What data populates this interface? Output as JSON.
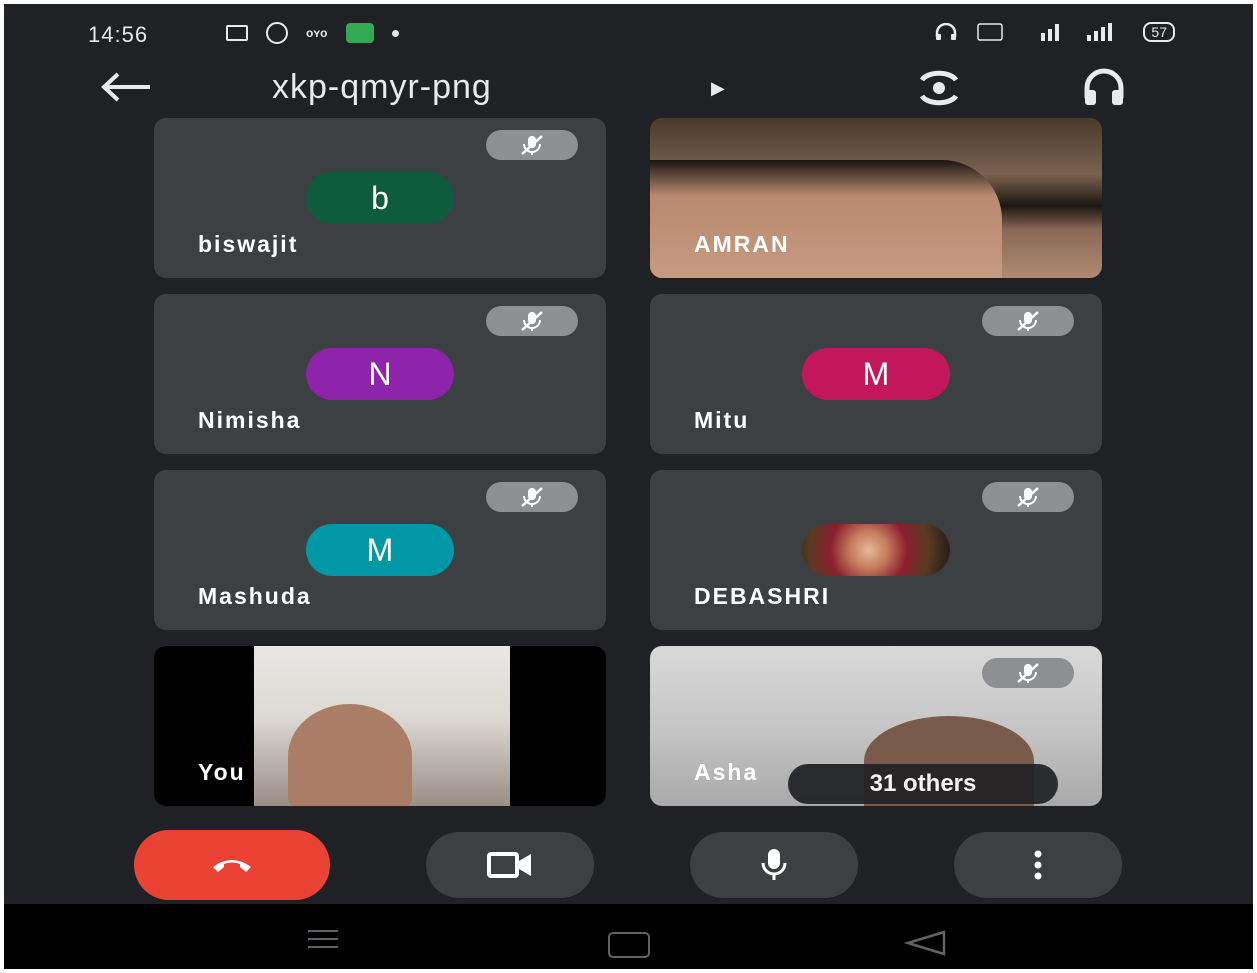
{
  "status_bar": {
    "time": "14:56",
    "left_icons": [
      "video-camera-icon",
      "whatsapp-icon",
      "oyo-icon",
      "call-icon",
      "dot-icon"
    ],
    "right_icons": [
      "headphones-icon",
      "volte-icon",
      "signal-4g-icon",
      "signal-icon"
    ],
    "battery": "57"
  },
  "header": {
    "title": "xkp-qmyr-png",
    "back_icon": "arrow-left-icon",
    "title_arrow_icon": "play-arrow-icon",
    "switch_camera_icon": "switch-camera-icon",
    "audio_output_icon": "headphones-icon"
  },
  "participants": [
    {
      "name": "biswajit",
      "initial": "b",
      "avatar_color": "#0f5b3e",
      "muted": true,
      "video": false
    },
    {
      "name": "AMRAN",
      "initial": "",
      "muted": false,
      "video": true
    },
    {
      "name": "Nimisha",
      "initial": "N",
      "avatar_color": "#8e24aa",
      "muted": true,
      "video": false
    },
    {
      "name": "Mitu",
      "initial": "M",
      "avatar_color": "#c2185b",
      "muted": true,
      "video": false
    },
    {
      "name": "Mashuda",
      "initial": "M",
      "avatar_color": "#0097a7",
      "muted": true,
      "video": false
    },
    {
      "name": "DEBASHRI",
      "initial": "",
      "muted": true,
      "video": false
    },
    {
      "name": "You",
      "initial": "",
      "muted": false,
      "video": true
    },
    {
      "name": "Asha",
      "initial": "",
      "muted": true,
      "video": true
    }
  ],
  "others_label": "31 others",
  "controls": {
    "end_call_icon": "end-call-icon",
    "camera_icon": "video-camera-icon",
    "mic_icon": "microphone-icon",
    "more_icon": "more-vertical-icon",
    "end_call_color": "#ea4335"
  },
  "nav": [
    "menu-icon",
    "home-icon",
    "back-triangle-icon"
  ]
}
